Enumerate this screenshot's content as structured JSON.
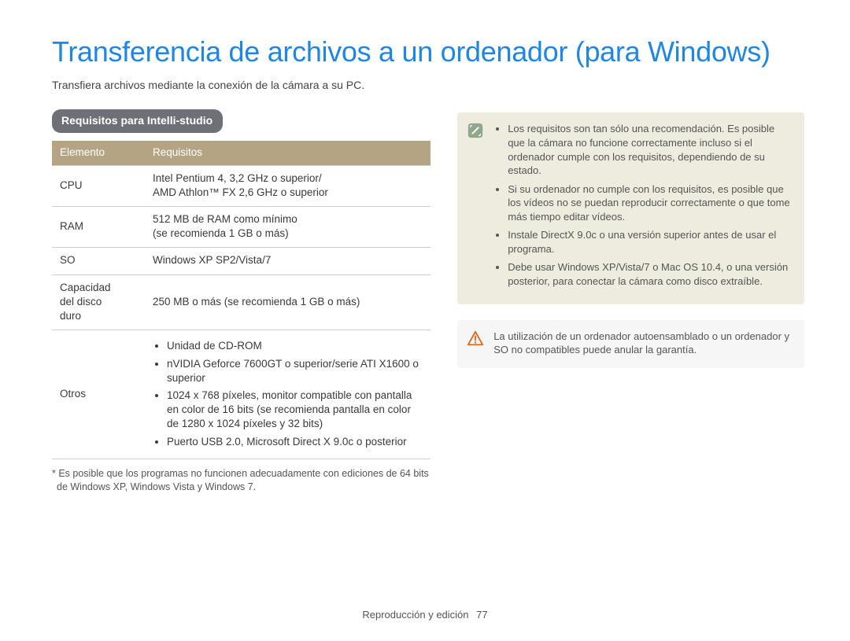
{
  "title": "Transferencia de archivos a un ordenador (para Windows)",
  "subtitle": "Transfiera archivos mediante la conexión de la cámara a su PC.",
  "section_chip": "Requisitos para Intelli-studio",
  "table": {
    "headers": {
      "col1": "Elemento",
      "col2": "Requisitos"
    },
    "rows": {
      "cpu": {
        "label": "CPU",
        "value_line1": "Intel Pentium 4, 3,2 GHz o superior/",
        "value_line2": "AMD Athlon™ FX 2,6 GHz o superior"
      },
      "ram": {
        "label": "RAM",
        "value_line1": "512 MB de RAM como mínimo",
        "value_line2": "(se recomienda 1 GB o más)"
      },
      "os": {
        "label": "SO",
        "value": "Windows XP SP2/Vista/7"
      },
      "disk": {
        "label_l1": "Capacidad",
        "label_l2": "del disco",
        "label_l3": "duro",
        "value": "250 MB o más (se recomienda 1 GB o más)"
      },
      "other": {
        "label": "Otros",
        "items": [
          "Unidad de CD-ROM",
          "nVIDIA Geforce 7600GT o superior/serie ATI X1600 o superior",
          "1024 x 768 píxeles, monitor compatible con pantalla en color de 16 bits (se recomienda pantalla en color de 1280 x 1024 píxeles y 32 bits)",
          "Puerto USB 2.0, Microsoft Direct X 9.0c o posterior"
        ]
      }
    }
  },
  "footnote": "* Es posible que los programas no funcionen adecuadamente con ediciones de 64 bits de Windows XP, Windows Vista y Windows 7.",
  "info_box": {
    "items": [
      "Los requisitos son tan sólo una recomendación. Es posible que la cámara no funcione correctamente incluso si el ordenador cumple con los requisitos, dependiendo de su estado.",
      "Si su ordenador no cumple con los requisitos, es posible que los vídeos no se puedan reproducir correctamente o que tome más tiempo editar vídeos.",
      "Instale DirectX 9.0c o una versión superior antes de usar el programa.",
      "Debe usar Windows XP/Vista/7 o Mac OS 10.4, o una versión posterior, para conectar la cámara como disco extraíble."
    ]
  },
  "warn_box": {
    "text": "La utilización de un ordenador autoensamblado o un ordenador y SO no compatibles puede anular la garantía."
  },
  "footer": {
    "section": "Reproducción y edición",
    "page": "77"
  }
}
